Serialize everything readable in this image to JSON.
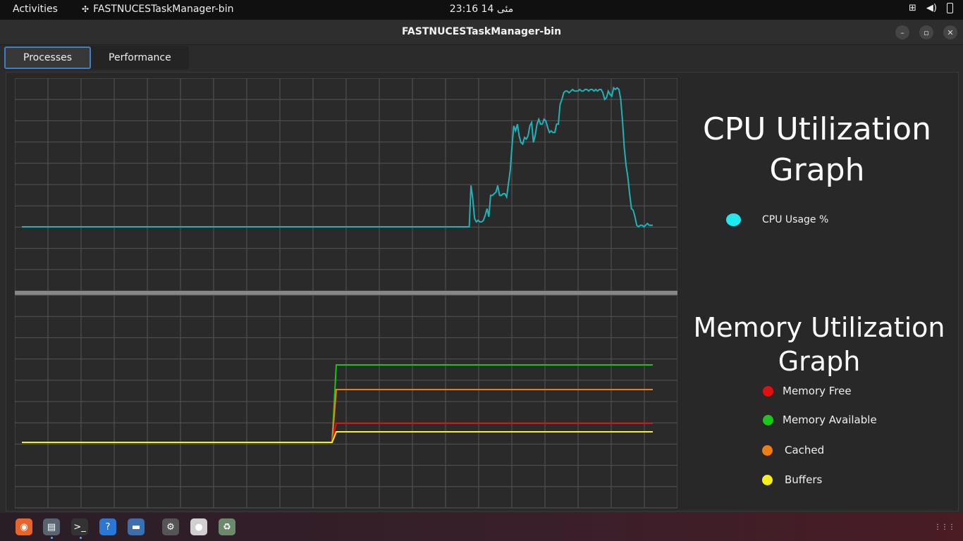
{
  "topbar": {
    "activities": "Activities",
    "app_name": "FASTNUCESTaskManager-bin",
    "clock": "23:16  14 مئى"
  },
  "window": {
    "title": "FASTNUCESTaskManager-bin",
    "tabs": [
      {
        "label": "Processes",
        "active": true
      },
      {
        "label": "Performance",
        "active": false
      }
    ]
  },
  "cpu_panel": {
    "title_line1": "CPU Utilization",
    "title_line2": "Graph",
    "legend": [
      {
        "label": "CPU Usage %",
        "color": "#1ee8f0"
      }
    ]
  },
  "memory_panel": {
    "title_line1": "Memory Utilization",
    "title_line2": "Graph",
    "legend": [
      {
        "label": "Memory Free",
        "color": "#e01010"
      },
      {
        "label": "Memory Available",
        "color": "#1ac81a"
      },
      {
        "label": "Cached",
        "color": "#f07d10"
      },
      {
        "label": "Buffers",
        "color": "#f5f01a"
      }
    ]
  },
  "chart_data": [
    {
      "type": "line",
      "series": [
        {
          "name": "CPU Usage %",
          "color": "#1fb3b8",
          "values": [
            2,
            2,
            2,
            2,
            2,
            2,
            2,
            2,
            2,
            2,
            2,
            2,
            2,
            2,
            2,
            2,
            2,
            2,
            2,
            2,
            2,
            2,
            2,
            2,
            2,
            2,
            2,
            2,
            2,
            2,
            2,
            2,
            2,
            2,
            2,
            2,
            2,
            2,
            2,
            2,
            2,
            2,
            2,
            2,
            2,
            2,
            2,
            2,
            2,
            2,
            2,
            2,
            2,
            2,
            2,
            2,
            2,
            2,
            2,
            2,
            2,
            2,
            2,
            2,
            2,
            2,
            2,
            2,
            2,
            2,
            2,
            2,
            2,
            2,
            2,
            2,
            2,
            2,
            2,
            2,
            2,
            2,
            2,
            2,
            2,
            2,
            2,
            2,
            2,
            2,
            2,
            2,
            2,
            2,
            2,
            2,
            2,
            2,
            2,
            2,
            2,
            2,
            2,
            2,
            2,
            2,
            2,
            2,
            2,
            2,
            2,
            2,
            2,
            2,
            2,
            2,
            2,
            2,
            2,
            2,
            2,
            2,
            2,
            2,
            2,
            2,
            2,
            2,
            2,
            2,
            2,
            2,
            2,
            2,
            2,
            2,
            2,
            2,
            2,
            2,
            2,
            2,
            2,
            2,
            2,
            2,
            2,
            2,
            2,
            2,
            2,
            2,
            2,
            2,
            2,
            2,
            2,
            2,
            2,
            2,
            2,
            2,
            2,
            2,
            2,
            2,
            2,
            2,
            2,
            2,
            2,
            2,
            2,
            2,
            2,
            2,
            2,
            2,
            2,
            2,
            2,
            2,
            2,
            2,
            2,
            2,
            2,
            2,
            2,
            2,
            2,
            2,
            2,
            2,
            2,
            2,
            2,
            2,
            2,
            2,
            2,
            2,
            2,
            2,
            2,
            2,
            2,
            2,
            2,
            2,
            2,
            2,
            2,
            2,
            2,
            2,
            2,
            2,
            2,
            2,
            2,
            2,
            2,
            2,
            2,
            2,
            2,
            2,
            2,
            2,
            2,
            2,
            2,
            2,
            2,
            2,
            2,
            2,
            2,
            2,
            2,
            2,
            2,
            2,
            2,
            2,
            2,
            2,
            2,
            2,
            2,
            2,
            27,
            19,
            7,
            5,
            6,
            5,
            5,
            6,
            9,
            13,
            8,
            21,
            21,
            22,
            23,
            27,
            21,
            21,
            22,
            22,
            20,
            28,
            36,
            51,
            63,
            60,
            64,
            57,
            53,
            52,
            56,
            55,
            57,
            63,
            65,
            53,
            57,
            64,
            67,
            64,
            64,
            67,
            66,
            62,
            59,
            60,
            59,
            59,
            64,
            64,
            76,
            79,
            83,
            84,
            84,
            83,
            84,
            85,
            84,
            84,
            84,
            85,
            84,
            84,
            85,
            85,
            84,
            85,
            85,
            84,
            85,
            84,
            85,
            85,
            83,
            79,
            80,
            84,
            82,
            81,
            86,
            85,
            86,
            85,
            79,
            66,
            50,
            39,
            32,
            22,
            13,
            12,
            8,
            3,
            2,
            3,
            3,
            2,
            3,
            4,
            3,
            3,
            3
          ]
        }
      ],
      "ylim": [
        0,
        100
      ]
    },
    {
      "type": "line",
      "series": [
        {
          "name": "Memory Available",
          "color": "#16c416",
          "values_start": 0,
          "values_end": 36
        },
        {
          "name": "Cached",
          "color": "#f07d10",
          "values_start": 0,
          "values_end": 25
        },
        {
          "name": "Memory Free",
          "color": "#e01010",
          "values_start": 0,
          "values_end": 9
        },
        {
          "name": "Buffers",
          "color": "#f2f21e",
          "values_start": 0,
          "values_end": 5
        }
      ]
    }
  ],
  "dock": {
    "apps": [
      {
        "name": "firefox-icon",
        "color": "#e8642a",
        "glyph": "◉"
      },
      {
        "name": "files-icon",
        "color": "#5a6470",
        "glyph": "▤"
      },
      {
        "name": "terminal-icon",
        "color": "#333333",
        "glyph": ">_"
      },
      {
        "name": "help-icon",
        "color": "#2a78d6",
        "glyph": "?"
      },
      {
        "name": "image-viewer-icon",
        "color": "#3a6fb0",
        "glyph": "▬"
      },
      {
        "name": "settings-icon",
        "color": "#555555",
        "glyph": "⚙"
      },
      {
        "name": "disc-icon",
        "color": "#d0d0d0",
        "glyph": "●"
      },
      {
        "name": "trash-icon",
        "color": "#6b8a6b",
        "glyph": "♻"
      }
    ]
  }
}
